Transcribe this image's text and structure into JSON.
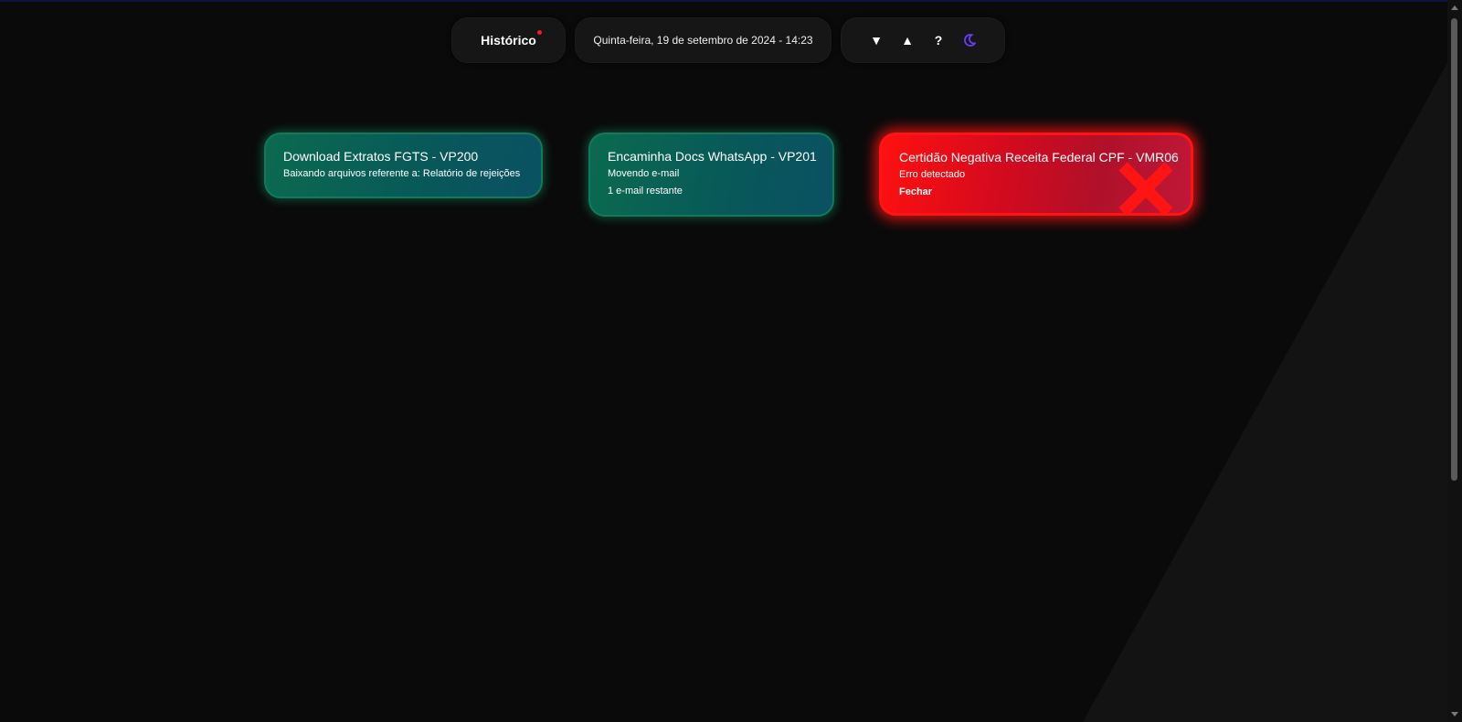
{
  "header": {
    "history_label": "Histórico",
    "date_text": "Quinta-feira, 19 de setembro de 2024 - 14:23",
    "controls": {
      "down": "▼",
      "up": "▲",
      "help": "?",
      "theme_icon": "moon-icon"
    }
  },
  "cards": [
    {
      "title": "Download Extratos FGTS - VP200",
      "lines": [
        "Baixando arquivos referente a: Relatório de rejeições"
      ],
      "status": "running"
    },
    {
      "title": "Encaminha Docs WhatsApp - VP201",
      "lines": [
        "Movendo e-mail",
        "1 e-mail restante"
      ],
      "status": "running"
    },
    {
      "title": "Certidão Negativa Receita Federal CPF - VMR06",
      "lines": [
        "Erro detectado"
      ],
      "close_label": "Fechar",
      "status": "error"
    }
  ],
  "colors": {
    "background": "#0a0a0a",
    "running_card": "#08585a",
    "error_card": "#ff1414",
    "notification_dot": "#ff1a1a",
    "theme_icon": "#6a3cff"
  }
}
